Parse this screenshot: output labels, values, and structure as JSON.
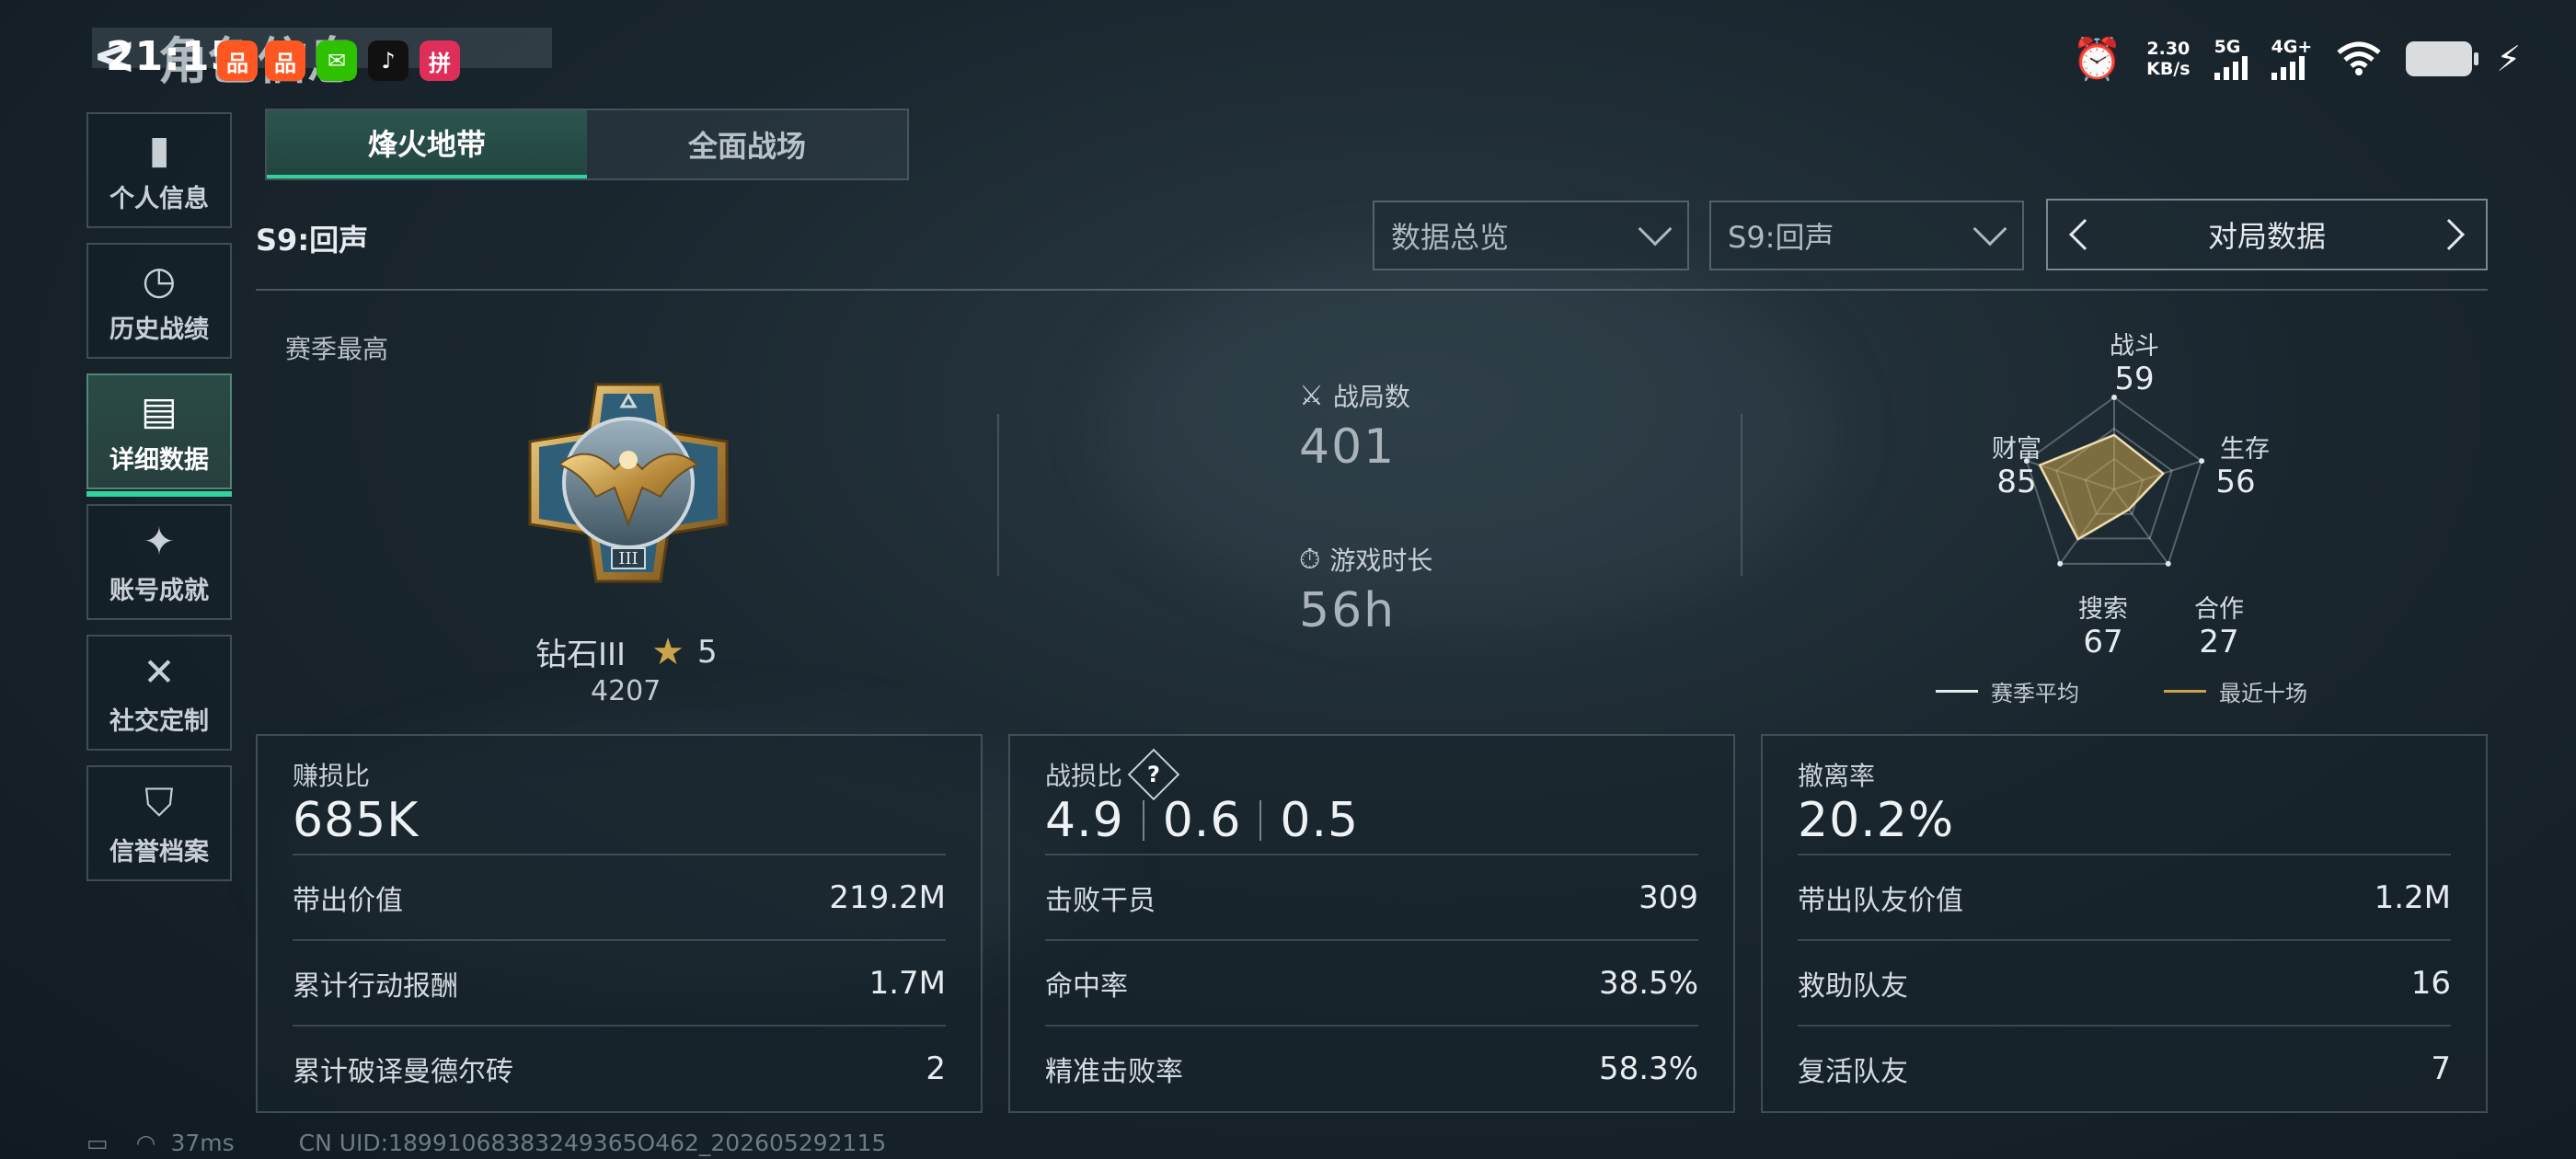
{
  "status_bar": {
    "clock": "21:15",
    "net_speed_value": "2.30",
    "net_speed_unit": "KB/s",
    "signal_1": "5G",
    "signal_2": "4G+",
    "page_title": "角色信息",
    "apps": [
      {
        "name": "app-icon-1",
        "glyph": "品",
        "color": "#ff5722"
      },
      {
        "name": "app-icon-2",
        "glyph": "品",
        "color": "#ff5722"
      },
      {
        "name": "wechat-icon",
        "glyph": "✉",
        "color": "#2dc100"
      },
      {
        "name": "tiktok-icon",
        "glyph": "♪",
        "color": "#111111"
      },
      {
        "name": "app-icon-5",
        "glyph": "拼",
        "color": "#e02e5a"
      }
    ]
  },
  "nav": [
    {
      "label": "个人信息",
      "icon": "bar-chart-icon",
      "glyph": "▮"
    },
    {
      "label": "历史战绩",
      "icon": "history-icon",
      "glyph": "◷"
    },
    {
      "label": "详细数据",
      "icon": "detail-data-icon",
      "glyph": "▤",
      "active": true
    },
    {
      "label": "账号成就",
      "icon": "achievement-icon",
      "glyph": "✦"
    },
    {
      "label": "社交定制",
      "icon": "tools-icon",
      "glyph": "✕"
    },
    {
      "label": "信誉档案",
      "icon": "credit-icon",
      "glyph": "⛉"
    }
  ],
  "mode_tabs": [
    "烽火地带",
    "全面战场"
  ],
  "season_title": "S9:回声",
  "filters": {
    "overview": "数据总览",
    "season": "S9:回声",
    "pager": "对局数据"
  },
  "best": {
    "label": "赛季最高",
    "rank": "钻石III",
    "stars": "5",
    "score": "4207"
  },
  "stats": {
    "matches_label": "战局数",
    "matches": "401",
    "playtime_label": "游戏时长",
    "playtime": "56h"
  },
  "radar": {
    "axes": [
      {
        "label": "战斗",
        "value": 59
      },
      {
        "label": "生存",
        "value": 56
      },
      {
        "label": "合作",
        "value": 27
      },
      {
        "label": "搜索",
        "value": 67
      },
      {
        "label": "财富",
        "value": 85
      }
    ],
    "legend_avg": "赛季平均",
    "legend_recent": "最近十场",
    "color_avg": "#e6ebee",
    "color_recent": "#c9a44a"
  },
  "cards": [
    {
      "title": "赚损比",
      "big": "685K",
      "rows": [
        {
          "label": "带出价值",
          "value": "219.2M"
        },
        {
          "label": "累计行动报酬",
          "value": "1.7M"
        },
        {
          "label": "累计破译曼德尔砖",
          "value": "2"
        }
      ]
    },
    {
      "title": "战损比",
      "help": "?",
      "big_parts": [
        "4.9",
        "0.6",
        "0.5"
      ],
      "rows": [
        {
          "label": "击败干员",
          "value": "309"
        },
        {
          "label": "命中率",
          "value": "38.5%"
        },
        {
          "label": "精准击败率",
          "value": "58.3%"
        }
      ]
    },
    {
      "title": "撤离率",
      "big": "20.2%",
      "rows": [
        {
          "label": "带出队友价值",
          "value": "1.2M"
        },
        {
          "label": "救助队友",
          "value": "16"
        },
        {
          "label": "复活队友",
          "value": "7"
        }
      ]
    }
  ],
  "footer": {
    "ping": "37ms",
    "uid": "CN UID:18991068383249365O462_202605292115"
  }
}
